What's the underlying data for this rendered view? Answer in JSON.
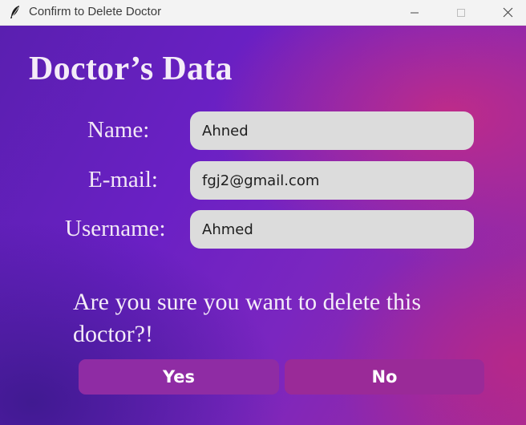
{
  "window": {
    "title": "Confirm to Delete Doctor",
    "controls": [
      "minimize-icon",
      "maximize-icon",
      "close-icon"
    ]
  },
  "form": {
    "heading": "Doctor’s Data",
    "fields": [
      {
        "label": "Name:",
        "value": "Ahned"
      },
      {
        "label": "E-mail:",
        "value": "fgj2@gmail.com"
      },
      {
        "label": "Username:",
        "value": "Ahmed"
      }
    ]
  },
  "confirm": {
    "question": "Are you sure you want to delete this doctor?!",
    "yes_label": "Yes",
    "no_label": "No"
  },
  "colors": {
    "background_start": "#5a1fb0",
    "background_end": "#c92c80",
    "field_bg": "#dcdcdc",
    "button_bg": "#8f2ca4"
  }
}
